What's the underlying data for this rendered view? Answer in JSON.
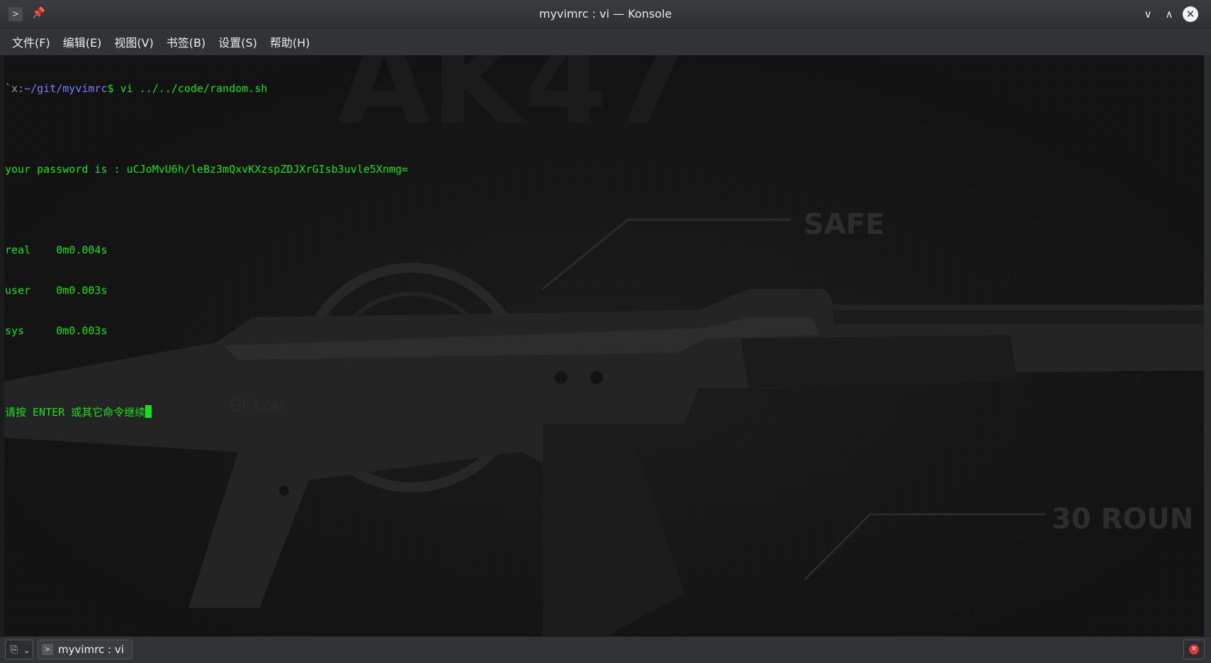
{
  "window": {
    "title": "myvimrc : vi — Konsole",
    "app_icon": "terminal-icon",
    "pin_icon": "📌",
    "minimize_icon": "∨",
    "maximize_icon": "∧",
    "close_icon": "✕"
  },
  "menu": {
    "items": [
      "文件(F)",
      "编辑(E)",
      "视图(V)",
      "书签(B)",
      "设置(S)",
      "帮助(H)"
    ]
  },
  "terminal": {
    "prompt_user": "`x:",
    "prompt_path": "~/git/myvimrc",
    "prompt_symbol": "$ ",
    "command": "vi ../../code/random.sh",
    "password_line": "your password is : uCJoMvU6h/leBz3mQxvKXzspZDJXrGIsb3uvle5Xnmg=",
    "timing": [
      {
        "label": "real",
        "value": "0m0.004s"
      },
      {
        "label": "user",
        "value": "0m0.003s"
      },
      {
        "label": "sys",
        "value": "0m0.003s"
      }
    ],
    "continue_prompt": "请按 ENTER 或其它命令继续",
    "text_color": "#18e018",
    "path_color": "#7a7cff"
  },
  "wallpaper": {
    "title": "AK47",
    "safe_label": "SAFE",
    "rounds_label": "30 ROUN",
    "watermark": "GFXzer"
  },
  "tabbar": {
    "newtab_icon": "new-tab-icon",
    "tab_label": "myvimrc : vi",
    "close_icon": "close-tab-icon"
  }
}
